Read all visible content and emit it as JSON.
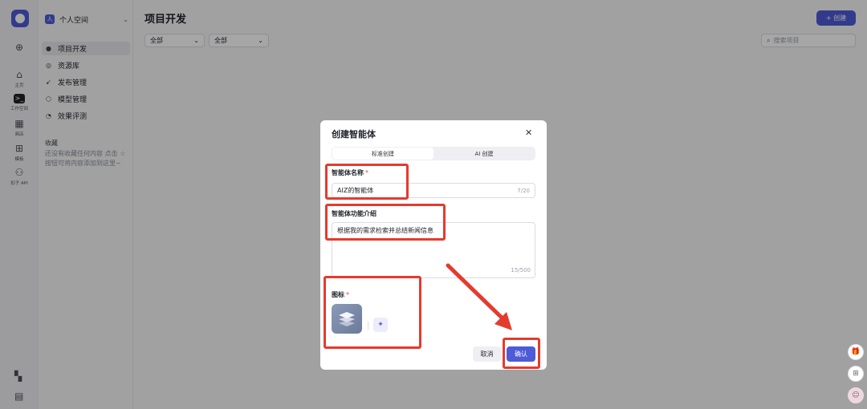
{
  "rail": {
    "items": [
      {
        "icon": "plus-circle-icon",
        "glyph": "⊕",
        "label": ""
      },
      {
        "icon": "home-icon",
        "glyph": "⌂",
        "label": "主页"
      },
      {
        "icon": "terminal-icon",
        "glyph": ">_",
        "label": "工作空间"
      },
      {
        "icon": "store-icon",
        "glyph": "▦",
        "label": "商店"
      },
      {
        "icon": "template-icon",
        "glyph": "⊞",
        "label": "模板"
      },
      {
        "icon": "api-icon",
        "glyph": "⚇",
        "label": "扣子 API"
      }
    ]
  },
  "sidebar": {
    "space_avatar": "人",
    "space_name": "个人空间",
    "items": [
      {
        "icon": "bot-icon",
        "glyph": "●",
        "label": "项目开发"
      },
      {
        "icon": "library-icon",
        "glyph": "◎",
        "label": "资源库"
      },
      {
        "icon": "rocket-icon",
        "glyph": "➹",
        "label": "发布管理"
      },
      {
        "icon": "model-icon",
        "glyph": "⬡",
        "label": "模型管理"
      },
      {
        "icon": "evaluate-icon",
        "glyph": "◔",
        "label": "效果评测"
      }
    ],
    "favorites_title": "收藏",
    "favorites_empty": "还没有收藏任何内容 点击 ☆ 按钮可将内容添加到这里~"
  },
  "main": {
    "title": "项目开发",
    "create_label": "+ 创建",
    "filters": [
      "全部",
      "全部"
    ],
    "search_placeholder": "搜索项目"
  },
  "modal": {
    "title": "创建智能体",
    "close": "✕",
    "tabs": [
      "标准创建",
      "AI 创建"
    ],
    "active_tab": 0,
    "name_label": "智能体名称",
    "name_value": "AIZ的智能体",
    "name_count": "7/20",
    "desc_label": "智能体功能介绍",
    "desc_value": "根据我的需求检索并总结新闻信息",
    "desc_count": "15/500",
    "icon_label": "图标",
    "required_mark": "*",
    "cancel_label": "取消",
    "confirm_label": "确认"
  },
  "colors": {
    "accent": "#4e5bd6",
    "annotation": "#e53a2e"
  }
}
